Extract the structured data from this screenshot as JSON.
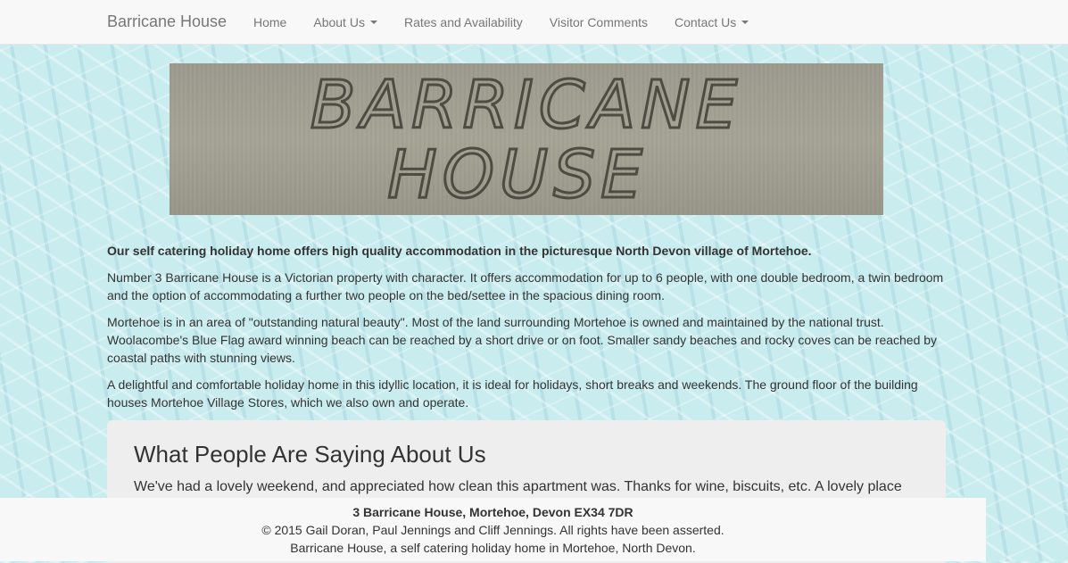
{
  "navbar": {
    "brand": "Barricane House",
    "items": [
      {
        "label": "Home"
      },
      {
        "label": "About Us"
      },
      {
        "label": "Rates and Availability"
      },
      {
        "label": "Visitor Comments"
      },
      {
        "label": "Contact Us"
      }
    ]
  },
  "banner": {
    "line1": "BARRICANE",
    "line2": "HOUSE"
  },
  "content": {
    "lead": "Our self catering holiday home offers high quality accommodation in the picturesque North Devon village of Mortehoe.",
    "p1": "Number 3 Barricane House is a Victorian property with character. It offers accommodation for up to 6 people, with one double bedroom, a twin bedroom and the option of accommodating a further two people on the bed/settee in the spacious dining room.",
    "p2": "Mortehoe is in an area of \"outstanding natural beauty\". Most of the land surrounding Mortehoe is owned and maintained by the national trust. Woolacombe's Blue Flag award winning beach can be reached by a short drive or on foot. Smaller sandy beaches and rocky coves can be reached by coastal paths with stunning views.",
    "p3": "A delightful and comfortable holiday home in this idyllic location, it is ideal for holidays, short breaks and weekends. The ground floor of the building houses Mortehoe Village Stores, which we also own and operate."
  },
  "testimonials": {
    "heading": "What People Are Saying About Us",
    "quote": "We've had a lovely weekend, and appreciated how clean this apartment was. Thanks for wine, biscuits, etc. A lovely place"
  },
  "footer": {
    "address": "3 Barricane House, Mortehoe, Devon EX34 7DR",
    "copyright": "© 2015 Gail Doran, Paul Jennings and Cliff Jennings. All rights have been asserted.",
    "tagline": "Barricane House, a self catering holiday home in Mortehoe, North Devon."
  }
}
